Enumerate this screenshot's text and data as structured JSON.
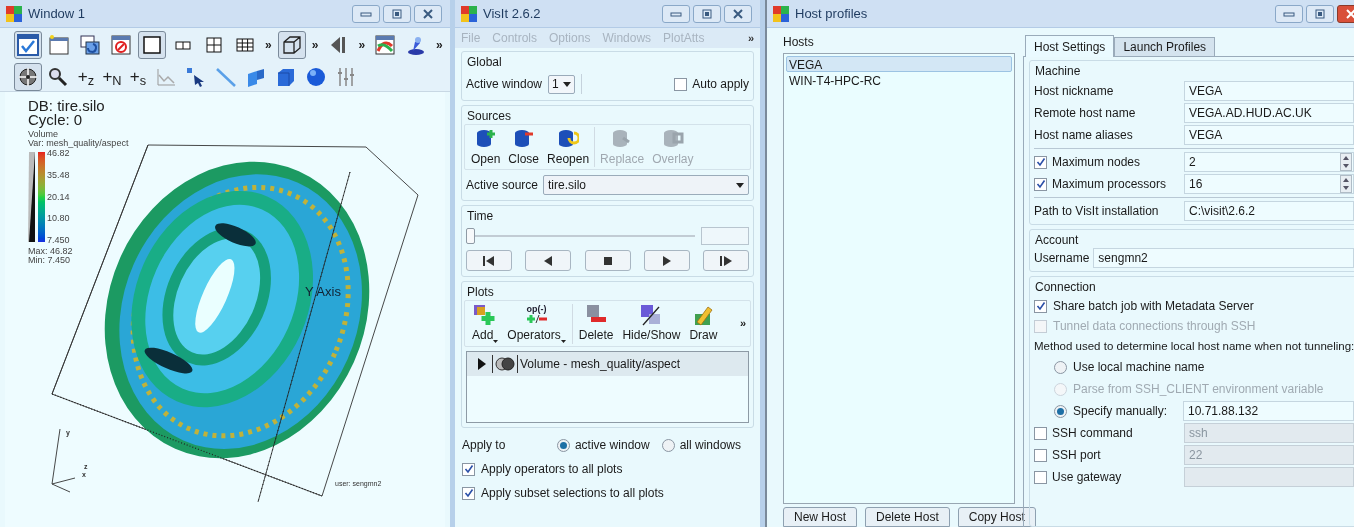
{
  "viewer_window": {
    "title": "Window 1",
    "toolbar_1": [
      {
        "selected": true
      },
      {
        "selected": false
      },
      {
        "selected": false
      },
      {
        "selected": false
      },
      {
        "selected": true
      },
      {
        "selected": false
      },
      {
        "selected": false
      },
      {
        "selected": false
      },
      {
        "label": "»"
      },
      {
        "selected": true
      },
      {
        "label": "»"
      },
      {
        "selected": false
      },
      {
        "label": "»"
      },
      {
        "selected": false
      },
      {
        "selected": false
      },
      {
        "label": "»"
      }
    ],
    "toolbar_2": [
      {
        "selected": true
      },
      {
        "selected": false
      },
      {
        "label": "+$_{z}$"
      },
      {
        "label": "+$_{N}$"
      },
      {
        "label": "+$_{s}$"
      },
      {
        "selected": false
      },
      {
        "selected": false
      },
      {
        "selected": false
      },
      {
        "selected": false
      },
      {
        "selected": false
      },
      {
        "selected": false
      },
      {
        "selected": false
      }
    ],
    "database": "DB: tire.silo",
    "cycle": "Cycle: 0",
    "legend": {
      "plot": "Volume",
      "variable": "Var: mesh_quality/aspect",
      "ticks": [
        "46.82",
        "35.48",
        "20.14",
        "10.80",
        "7.450"
      ],
      "max": "Max: 46.82",
      "min": "Min: 7.450"
    },
    "axis_label": "Y Axis",
    "triad": [
      "y",
      "z",
      "x"
    ],
    "user": "user: sengmn2"
  },
  "main_window": {
    "title": "VisIt 2.6.2",
    "menu": [
      "File",
      "Controls",
      "Options",
      "Windows",
      "PlotAtts"
    ],
    "menu_more": "»",
    "global": {
      "title": "Global",
      "active_window_label": "Active window",
      "active_window": "1",
      "auto_apply": {
        "label": "Auto apply",
        "checked": false
      }
    },
    "sources": {
      "title": "Sources",
      "buttons": [
        {
          "label": "Open",
          "disabled": false
        },
        {
          "label": "Close",
          "disabled": false
        },
        {
          "label": "Reopen",
          "disabled": false
        },
        {
          "label": "Replace",
          "disabled": true
        },
        {
          "label": "Overlay",
          "disabled": true
        }
      ],
      "active_source_label": "Active source",
      "active_source": "tire.silo"
    },
    "time": {
      "title": "Time",
      "level": 0
    },
    "plots": {
      "title": "Plots",
      "buttons": [
        {
          "label": "Add",
          "menu": true
        },
        {
          "label": "Operators",
          "menu": true,
          "icon_text": "op(-)"
        },
        {
          "label": "Delete",
          "menu": false
        },
        {
          "label": "Hide/Show",
          "menu": false
        },
        {
          "label": "Draw",
          "menu": false
        }
      ],
      "more": "»",
      "list": [
        {
          "label": "Volume - mesh_quality/aspect",
          "expanded": false,
          "selected": true
        }
      ]
    },
    "apply_to": {
      "label": "Apply to",
      "options": [
        {
          "label": "active window",
          "selected": true
        },
        {
          "label": "all windows",
          "selected": false
        }
      ]
    },
    "checkboxes": [
      {
        "label": "Apply operators to all plots",
        "checked": true
      },
      {
        "label": "Apply subset selections to all plots",
        "checked": true
      }
    ]
  },
  "host_profiles": {
    "title": "Host profiles",
    "hosts_label": "Hosts",
    "hosts": [
      {
        "label": "VEGA",
        "selected": true
      },
      {
        "label": "WIN-T4-HPC-RC",
        "selected": false
      }
    ],
    "buttons": [
      "New Host",
      "Delete Host",
      "Copy Host"
    ],
    "tabs": [
      {
        "label": "Host Settings",
        "selected": true
      },
      {
        "label": "Launch Profiles",
        "selected": false
      }
    ],
    "machine": {
      "title": "Machine",
      "fields": [
        {
          "label": "Host nickname",
          "value": "VEGA"
        },
        {
          "label": "Remote host name",
          "value": "VEGA.AD.HUD.AC.UK"
        },
        {
          "label": "Host name aliases",
          "value": "VEGA"
        }
      ],
      "limits": [
        {
          "label": "Maximum nodes",
          "checked": true,
          "value": "2"
        },
        {
          "label": "Maximum processors",
          "checked": true,
          "value": "16"
        }
      ],
      "path": {
        "label": "Path to VisIt installation",
        "value": "C:\\visit\\2.6.2"
      }
    },
    "account": {
      "title": "Account",
      "label": "Username",
      "value": "sengmn2"
    },
    "connection": {
      "title": "Connection",
      "checkboxes": [
        {
          "label": "Share batch job with Metadata Server",
          "checked": true,
          "disabled": false
        },
        {
          "label": "Tunnel data connections through SSH",
          "checked": false,
          "disabled": true
        }
      ],
      "method_label": "Method used to determine local host name when not tunneling:",
      "methods": [
        {
          "label": "Use local machine name",
          "selected": false,
          "disabled": false
        },
        {
          "label": "Parse from SSH_CLIENT environment variable",
          "selected": false,
          "disabled": true
        },
        {
          "label": "Specify manually:",
          "selected": true,
          "disabled": false,
          "value": "10.71.88.132"
        }
      ],
      "options": [
        {
          "label": "SSH command",
          "checked": false,
          "value": "ssh"
        },
        {
          "label": "SSH port",
          "checked": false,
          "value": "22"
        },
        {
          "label": "Use gateway",
          "checked": false
        }
      ]
    }
  }
}
